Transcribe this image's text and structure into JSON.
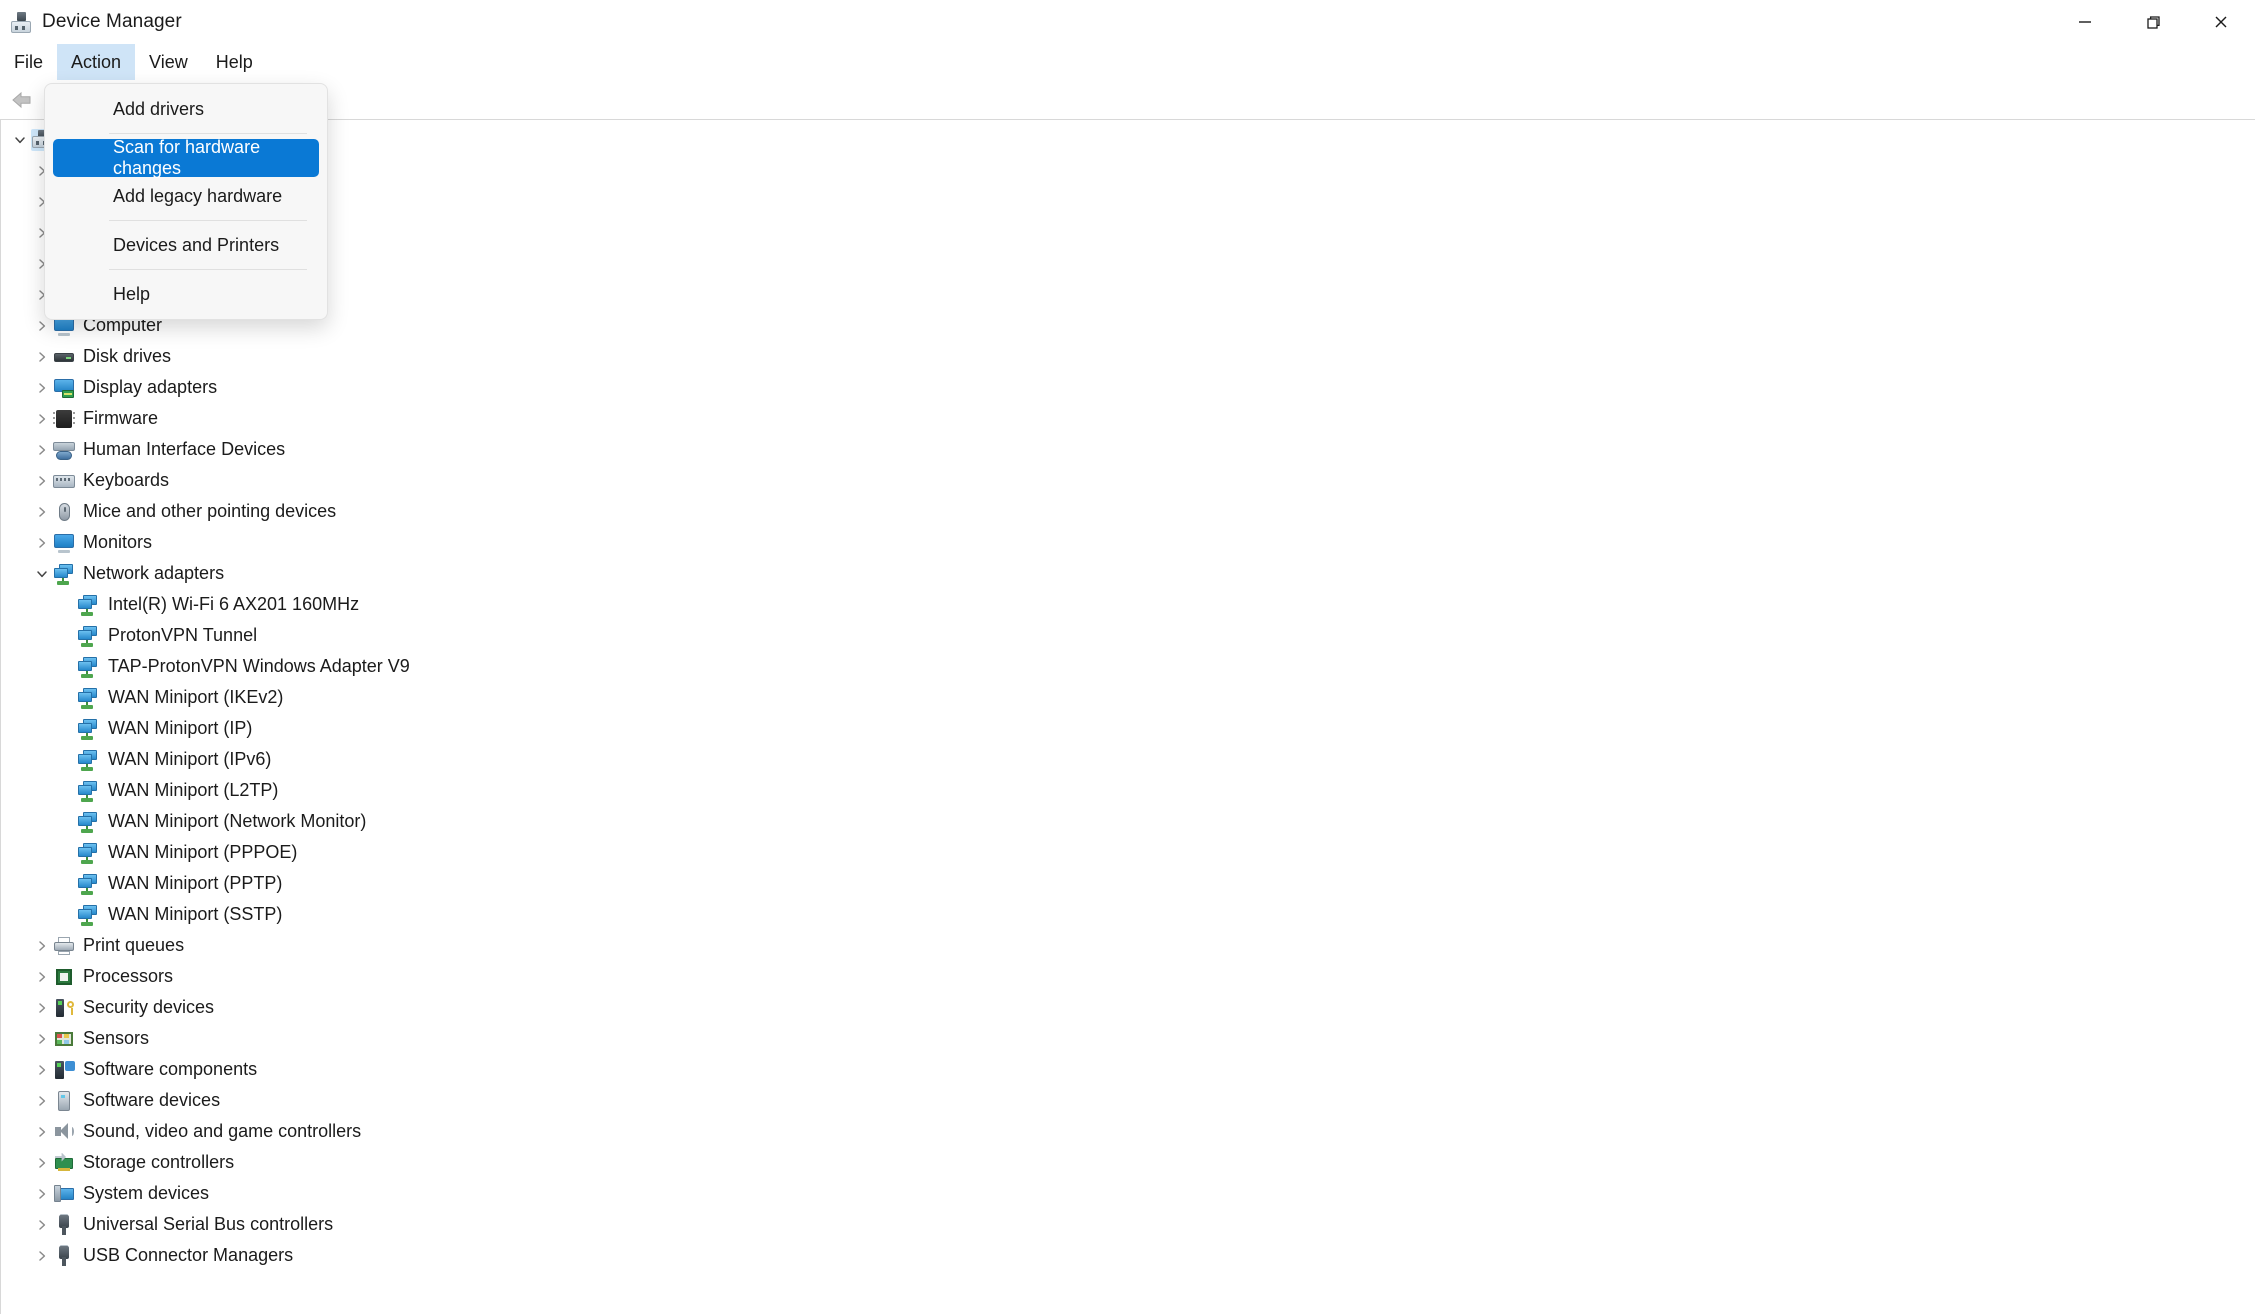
{
  "window": {
    "title": "Device Manager",
    "icon": "device-manager-icon",
    "controls": {
      "minimize": "—",
      "restore": "❐",
      "close": "✕"
    }
  },
  "menubar": {
    "items": [
      {
        "label": "File",
        "active": false
      },
      {
        "label": "Action",
        "active": true
      },
      {
        "label": "View",
        "active": false
      },
      {
        "label": "Help",
        "active": false
      }
    ]
  },
  "toolbar": {
    "items": [
      {
        "name": "back-arrow-icon",
        "enabled": false
      },
      {
        "name": "forward-arrow-icon",
        "enabled": false
      }
    ]
  },
  "action_menu": {
    "open": true,
    "items": [
      {
        "label": "Add drivers",
        "highlighted": false,
        "separator_after": true
      },
      {
        "label": "Scan for hardware changes",
        "highlighted": true,
        "separator_after": false
      },
      {
        "label": "Add legacy hardware",
        "highlighted": false,
        "separator_after": true
      },
      {
        "label": "Devices and Printers",
        "highlighted": false,
        "separator_after": true
      },
      {
        "label": "Help",
        "highlighted": false,
        "separator_after": false
      }
    ]
  },
  "tree": {
    "root": {
      "label": "",
      "expanded": true,
      "selected": true,
      "icon": "computer-root-icon"
    },
    "hidden_rows": 5,
    "categories": [
      {
        "label": "Computer",
        "icon": "monitor-icon",
        "expanded": false
      },
      {
        "label": "Disk drives",
        "icon": "disk-drive-icon",
        "expanded": false
      },
      {
        "label": "Display adapters",
        "icon": "display-adapter-icon",
        "expanded": false
      },
      {
        "label": "Firmware",
        "icon": "firmware-chip-icon",
        "expanded": false
      },
      {
        "label": "Human Interface Devices",
        "icon": "hid-icon",
        "expanded": false
      },
      {
        "label": "Keyboards",
        "icon": "keyboard-icon",
        "expanded": false
      },
      {
        "label": "Mice and other pointing devices",
        "icon": "mouse-icon",
        "expanded": false
      },
      {
        "label": "Monitors",
        "icon": "monitor-icon",
        "expanded": false
      },
      {
        "label": "Network adapters",
        "icon": "network-adapter-icon",
        "expanded": true,
        "children": [
          {
            "label": "Intel(R) Wi-Fi 6 AX201 160MHz",
            "icon": "network-adapter-icon"
          },
          {
            "label": "ProtonVPN Tunnel",
            "icon": "network-adapter-icon"
          },
          {
            "label": "TAP-ProtonVPN Windows Adapter V9",
            "icon": "network-adapter-icon"
          },
          {
            "label": "WAN Miniport (IKEv2)",
            "icon": "network-adapter-icon"
          },
          {
            "label": "WAN Miniport (IP)",
            "icon": "network-adapter-icon"
          },
          {
            "label": "WAN Miniport (IPv6)",
            "icon": "network-adapter-icon"
          },
          {
            "label": "WAN Miniport (L2TP)",
            "icon": "network-adapter-icon"
          },
          {
            "label": "WAN Miniport (Network Monitor)",
            "icon": "network-adapter-icon"
          },
          {
            "label": "WAN Miniport (PPPOE)",
            "icon": "network-adapter-icon"
          },
          {
            "label": "WAN Miniport (PPTP)",
            "icon": "network-adapter-icon"
          },
          {
            "label": "WAN Miniport (SSTP)",
            "icon": "network-adapter-icon"
          }
        ]
      },
      {
        "label": "Print queues",
        "icon": "printer-icon",
        "expanded": false
      },
      {
        "label": "Processors",
        "icon": "processor-icon",
        "expanded": false
      },
      {
        "label": "Security devices",
        "icon": "security-device-icon",
        "expanded": false
      },
      {
        "label": "Sensors",
        "icon": "sensor-icon",
        "expanded": false
      },
      {
        "label": "Software components",
        "icon": "software-component-icon",
        "expanded": false
      },
      {
        "label": "Software devices",
        "icon": "software-device-icon",
        "expanded": false
      },
      {
        "label": "Sound, video and game controllers",
        "icon": "sound-icon",
        "expanded": false
      },
      {
        "label": "Storage controllers",
        "icon": "storage-controller-icon",
        "expanded": false
      },
      {
        "label": "System devices",
        "icon": "system-device-icon",
        "expanded": false
      },
      {
        "label": "Universal Serial Bus controllers",
        "icon": "usb-icon",
        "expanded": false
      },
      {
        "label": "USB Connector Managers",
        "icon": "usb-icon",
        "expanded": false
      }
    ]
  },
  "colors": {
    "accent": "#0a79d5",
    "menu_active": "#cfe4f7",
    "selection": "#cfe8fb",
    "menu_bg": "#f7f7f7"
  }
}
